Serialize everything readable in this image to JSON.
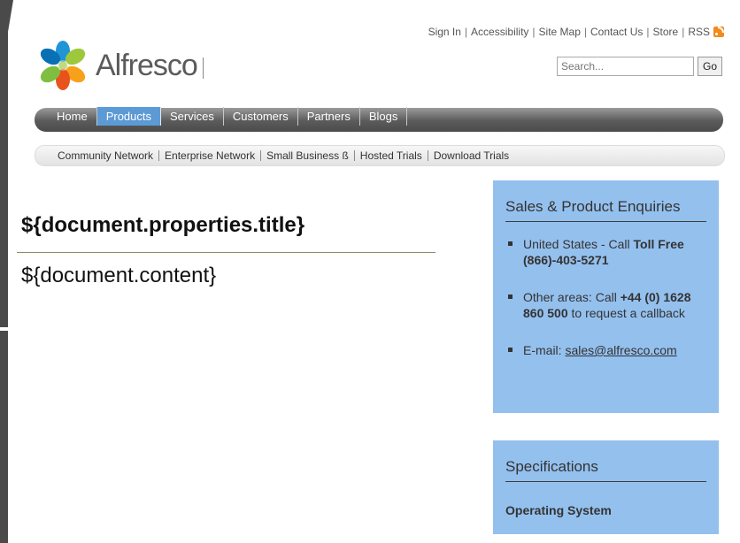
{
  "header": {
    "top_links": [
      "Sign In",
      "Accessibility",
      "Site Map",
      "Contact Us",
      "Store",
      "RSS"
    ],
    "logo_text": "Alfresco",
    "search": {
      "placeholder": "Search...",
      "button": "Go"
    }
  },
  "main_nav": [
    "Home",
    "Products",
    "Services",
    "Customers",
    "Partners",
    "Blogs"
  ],
  "sub_nav": [
    "Community Network",
    "Enterprise Network",
    "Small Business ß",
    "Hosted Trials",
    "Download Trials"
  ],
  "content": {
    "title": "${document.properties.title}",
    "body": "${document.content}"
  },
  "sales_box": {
    "title": "Sales & Product Enquiries",
    "us_prefix": "United States - Call ",
    "us_bold": "Toll Free (866)-403-5271",
    "other_prefix": "Other areas: Call ",
    "other_bold": "+44 (0) 1628 860 500",
    "other_suffix": " to request a callback",
    "email_prefix": "E-mail: ",
    "email": "sales@alfresco.com"
  },
  "specs_box": {
    "title": "Specifications",
    "item": "Operating System"
  },
  "colors": {
    "active_tab": "#5c9ad6",
    "sidebar_bg": "#94c0ee",
    "rss": "#f28b1c"
  }
}
